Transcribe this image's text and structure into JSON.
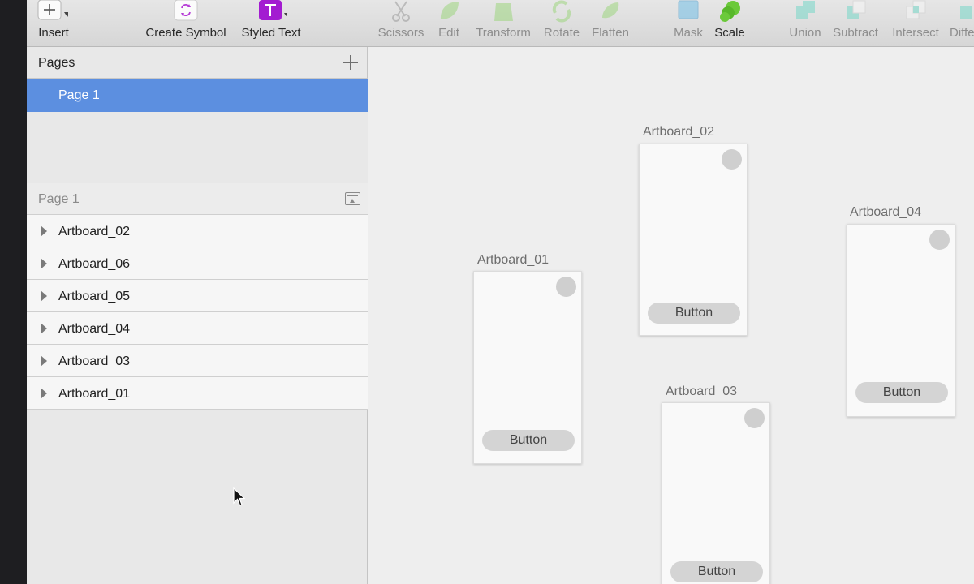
{
  "toolbar": {
    "insert": "Insert",
    "create_symbol": "Create Symbol",
    "styled_text": "Styled Text",
    "scissors": "Scissors",
    "edit": "Edit",
    "transform": "Transform",
    "rotate": "Rotate",
    "flatten": "Flatten",
    "mask": "Mask",
    "scale": "Scale",
    "union": "Union",
    "subtract": "Subtract",
    "intersect": "Intersect",
    "difference": "Diffe"
  },
  "sidebar": {
    "pages_title": "Pages",
    "selected_page": "Page 1",
    "layers_title": "Page 1",
    "layers": [
      "Artboard_02",
      "Artboard_06",
      "Artboard_05",
      "Artboard_04",
      "Artboard_03",
      "Artboard_01"
    ]
  },
  "canvas": {
    "artboards": [
      {
        "title": "Artboard_01",
        "button": "Button"
      },
      {
        "title": "Artboard_02",
        "button": "Button"
      },
      {
        "title": "Artboard_03",
        "button": "Button"
      },
      {
        "title": "Artboard_04",
        "button": "Button"
      }
    ]
  },
  "colors": {
    "selection": "#5c8fe0",
    "create_symbol_icon": "#b53bd6",
    "styled_text_icon": "#a31cd1",
    "boolean_ops": "#5fd5c3",
    "vector_ops": "#8fd36a"
  },
  "icons": [
    "plus-icon",
    "symbol-icon",
    "text-icon",
    "scissors-icon",
    "edit-icon",
    "transform-icon",
    "rotate-icon",
    "flatten-icon",
    "mask-icon",
    "scale-icon",
    "union-icon",
    "subtract-icon",
    "intersect-icon",
    "difference-icon"
  ]
}
